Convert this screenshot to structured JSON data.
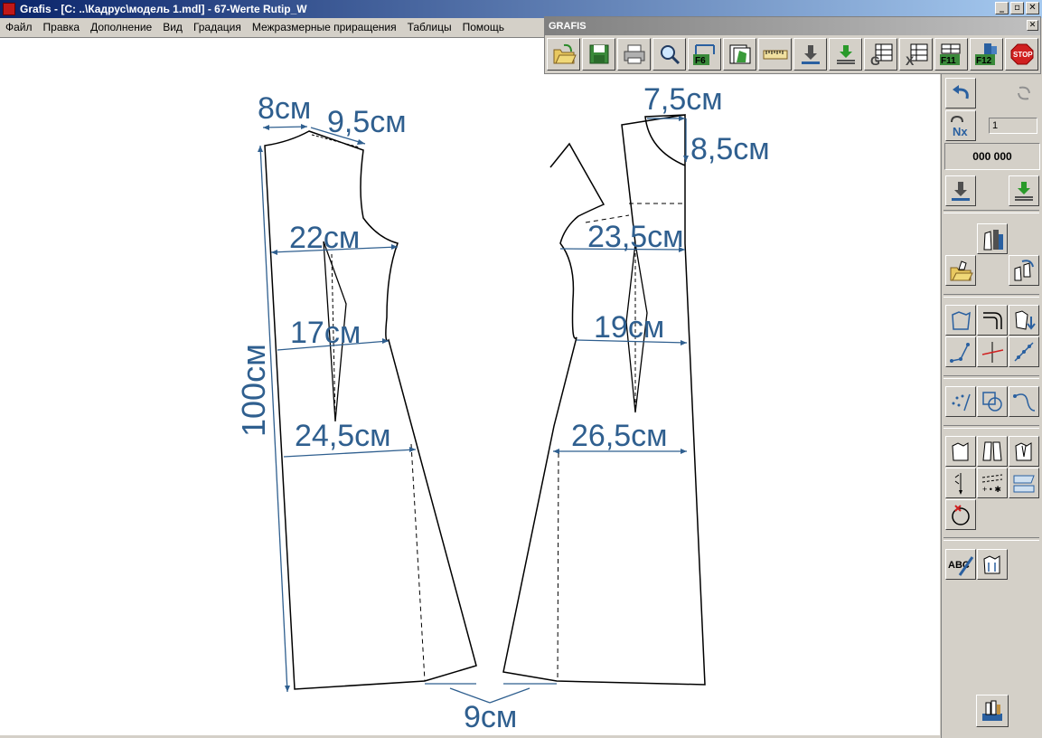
{
  "window": {
    "title": "Grafis - [C: ..\\Кадрус\\модель 1.mdl] - 67-Werte Rutip_W",
    "minimize": "_",
    "restore": "▫",
    "close": "✕"
  },
  "menu": [
    "Файл",
    "Правка",
    "Дополнение",
    "Вид",
    "Градация",
    "Межразмерные приращения",
    "Таблицы",
    "Помощь"
  ],
  "toolbar": {
    "title": "GRAFIS",
    "close": "✕",
    "buttons": [
      {
        "name": "open-folder-icon",
        "label": ""
      },
      {
        "name": "save-icon",
        "label": ""
      },
      {
        "name": "print-icon",
        "label": ""
      },
      {
        "name": "zoom-icon",
        "label": ""
      },
      {
        "name": "f6-icon",
        "label": "F6"
      },
      {
        "name": "pages-icon",
        "label": ""
      },
      {
        "name": "ruler-icon",
        "label": ""
      },
      {
        "name": "insert-down-icon",
        "label": ""
      },
      {
        "name": "insert-green-icon",
        "label": ""
      },
      {
        "name": "table-g-icon",
        "label": "G"
      },
      {
        "name": "table-x-icon",
        "label": "X"
      },
      {
        "name": "f11-icon",
        "label": "F11"
      },
      {
        "name": "f12-icon",
        "label": "F12"
      },
      {
        "name": "stop-icon",
        "label": "STOP"
      }
    ]
  },
  "sidepanel": {
    "nx_value": "1",
    "nx_label": "Nx",
    "counter": "000 000",
    "abc_label": "ABC"
  },
  "pattern": {
    "labels": {
      "back_neck_width": "8см",
      "back_shoulder": "9,5см",
      "front_neck_width": "7,5см",
      "front_neck_depth": "8,5см",
      "back_chest": "22см",
      "front_chest": "23,5см",
      "back_waist": "17см",
      "front_waist": "19см",
      "back_hip": "24,5см",
      "front_hip": "26,5см",
      "length": "100см",
      "hem_flare": "9см"
    }
  }
}
